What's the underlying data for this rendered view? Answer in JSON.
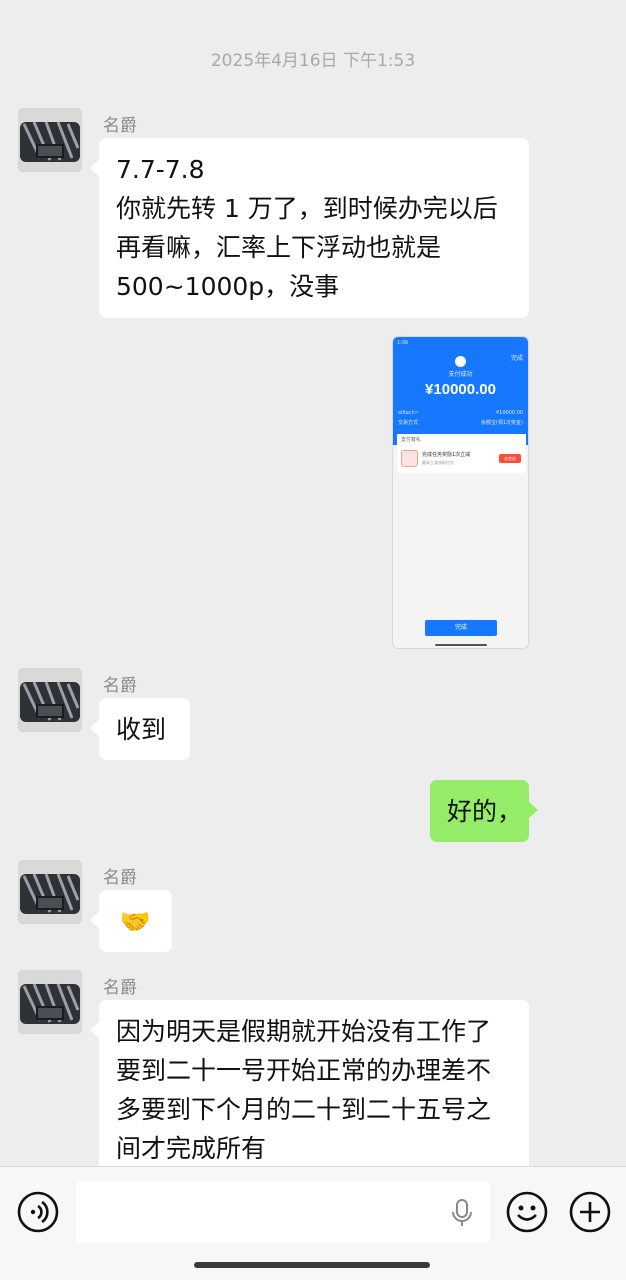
{
  "timestamp": "2025年4月16日 下午1:53",
  "sender_name": "名爵",
  "messages": {
    "m1": [
      "7.7-7.8",
      "你就先转 1 万了，到时候办完以后",
      "再看嘛，汇率上下浮动也就是",
      "500~1000p，没事"
    ],
    "m3": "收到",
    "m4": "好的，",
    "m5": "🤝",
    "m6": [
      "因为明天是假期就开始没有工作了",
      "要到二十一号开始正常的办理差不",
      "多要到下个月的二十到二十五号之",
      "间才完成所有"
    ]
  },
  "payment_screenshot": {
    "status_time": "1:06",
    "top_right": "完成",
    "status": "支付成功",
    "amount": "¥10000.00",
    "row1_left": "alitach~",
    "row1_right": "¥10000.00",
    "row2_left": "交易方式",
    "row2_right": "余额宝(领1次奖金)",
    "gift_title": "支付有礼",
    "task_text": "完成任务奖励1次立减",
    "task_sub": "最高立减领取红包",
    "task_button": "去完成",
    "done_button": "完成"
  },
  "colors": {
    "background": "#ededed",
    "bubble_incoming": "#ffffff",
    "bubble_outgoing": "#95ec69",
    "payment_blue": "#1677ff"
  },
  "icons": [
    "voice-mode-icon",
    "microphone-icon",
    "emoji-icon",
    "plus-icon"
  ]
}
